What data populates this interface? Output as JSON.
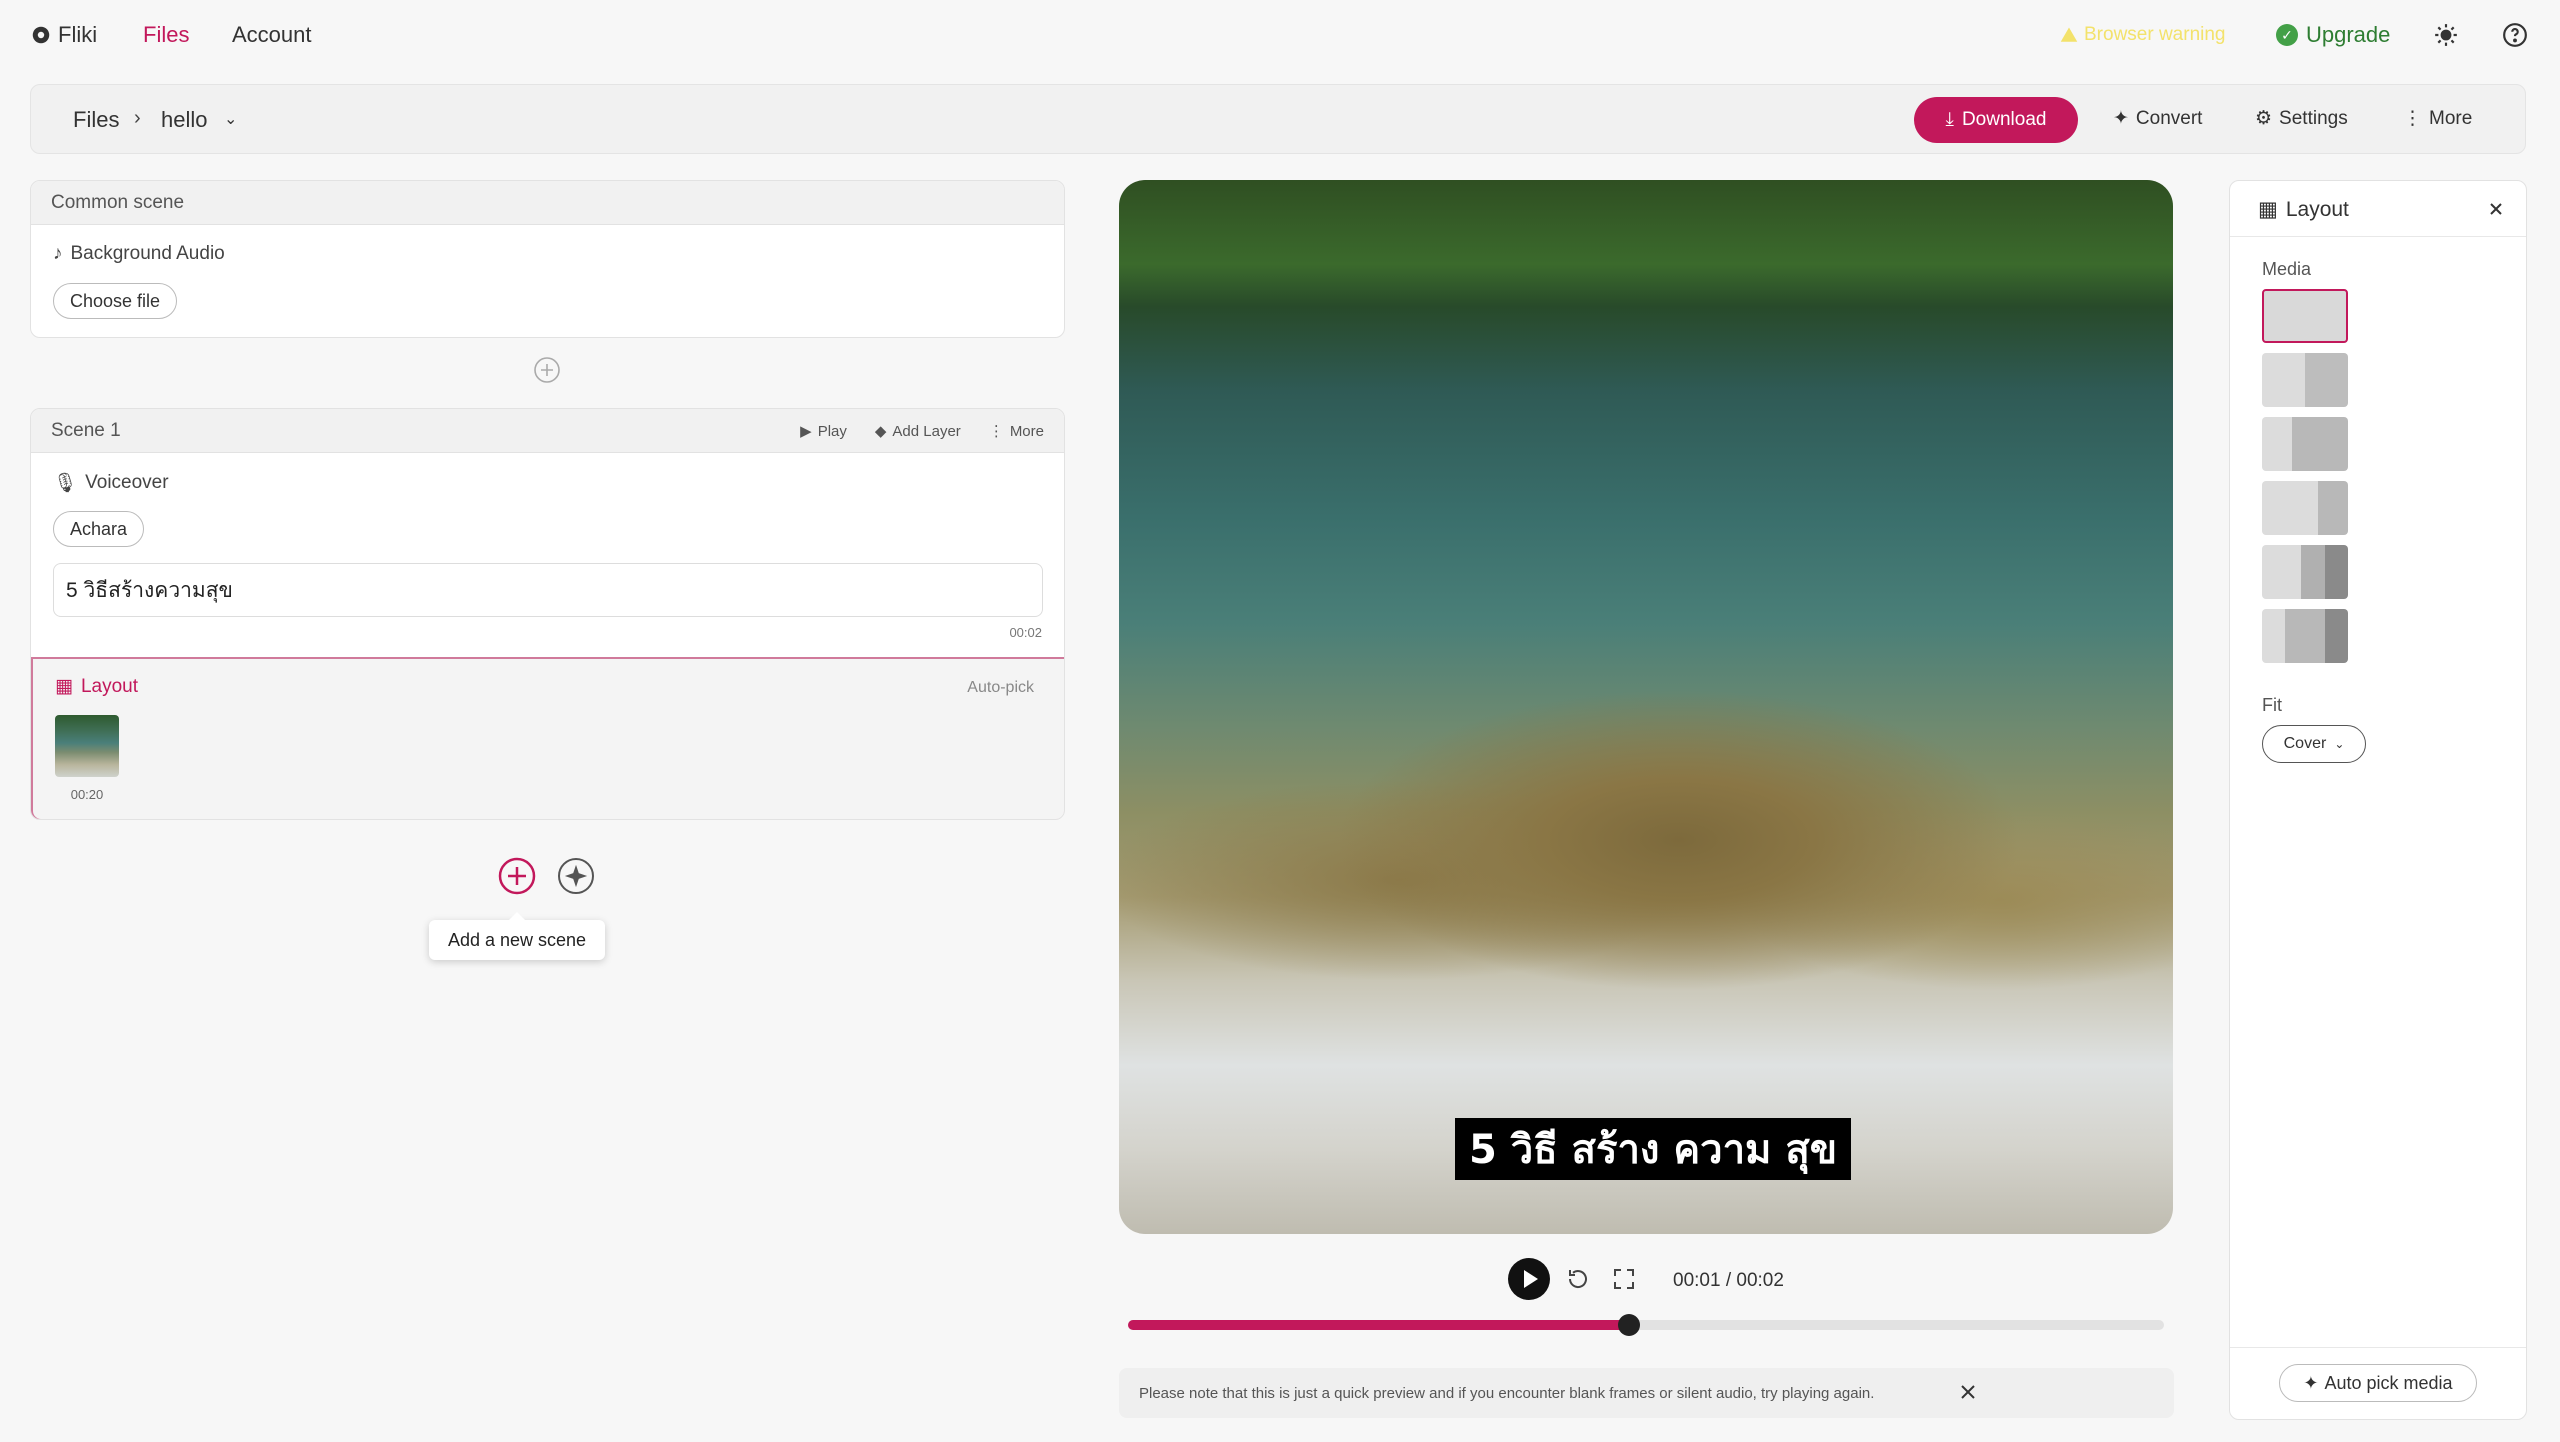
{
  "nav": {
    "brand": "Fliki",
    "files": "Files",
    "account": "Account",
    "warning": "Browser warning",
    "upgrade": "Upgrade"
  },
  "toolbar": {
    "crumb_root": "Files",
    "crumb_file": "hello",
    "download": "Download",
    "convert": "Convert",
    "settings": "Settings",
    "more": "More"
  },
  "common_scene": {
    "title": "Common scene",
    "audio_label": "Background Audio",
    "choose_file": "Choose file"
  },
  "scene": {
    "title": "Scene 1",
    "play": "Play",
    "add_layer": "Add Layer",
    "more": "More",
    "voiceover_label": "Voiceover",
    "voice": "Achara",
    "text": "5 วิธีสร้างความสุข",
    "text_duration": "00:02",
    "layout_title": "Layout",
    "autopick": "Auto-pick",
    "media_duration": "00:20"
  },
  "tooltip": "Add a new scene",
  "player": {
    "caption": "5 วิธี สร้าง ความ สุข",
    "time": "00:01 / 00:02",
    "progress": 0.484,
    "note": "Please note that this is just a quick preview and if you encounter blank frames or silent audio, try playing again."
  },
  "right_panel": {
    "title": "Layout",
    "media_label": "Media",
    "fit_label": "Fit",
    "fit_value": "Cover",
    "autopick_media": "Auto pick media"
  },
  "colors": {
    "accent": "#c2185b",
    "upgrade": "#2e7d32",
    "warning": "#f3e26b"
  }
}
